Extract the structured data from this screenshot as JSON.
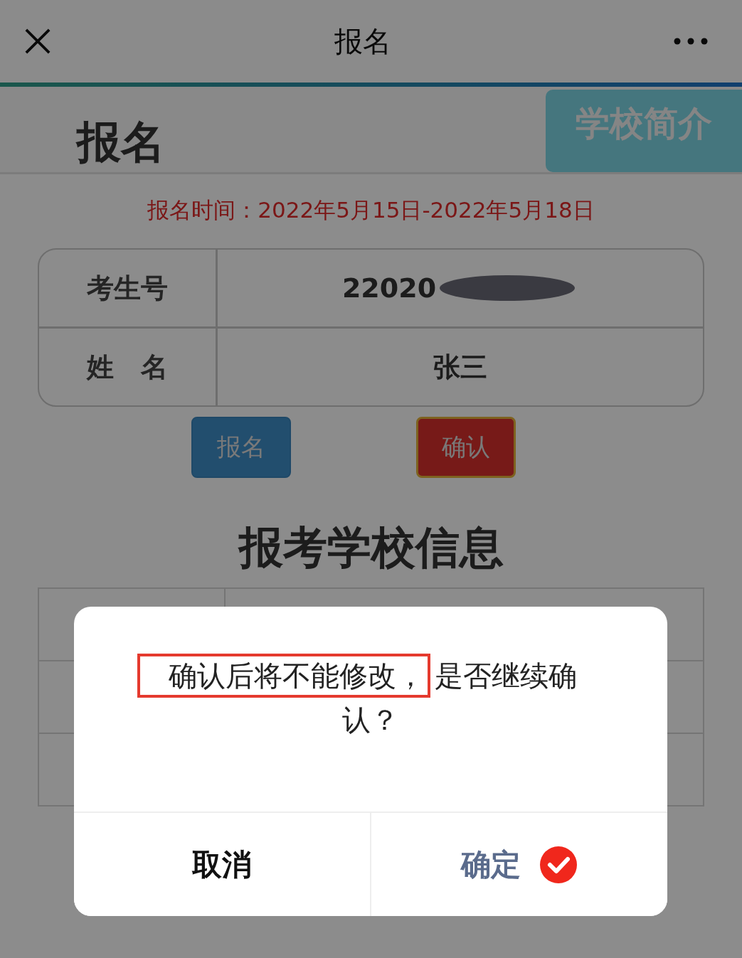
{
  "header": {
    "title": "报名"
  },
  "section": {
    "title": "报名",
    "tab": "学校简介"
  },
  "period": "报名时间：2022年5月15日-2022年5月18日",
  "student": [
    {
      "label": "考生号",
      "value": "22020",
      "redacted": true
    },
    {
      "label": "姓　名",
      "value": "张三",
      "redacted": false
    }
  ],
  "actions": [
    {
      "label": "报名",
      "kind": "primary"
    },
    {
      "label": "确认",
      "kind": "danger"
    }
  ],
  "school_section": {
    "title": "报考学校信息"
  },
  "dialog": {
    "message_marked": "确认后将不能修改，",
    "message_rest": "是否继续确认？",
    "buttons": [
      {
        "label": "取消",
        "kind": "cancel"
      },
      {
        "label": "确定",
        "kind": "confirm"
      }
    ]
  }
}
